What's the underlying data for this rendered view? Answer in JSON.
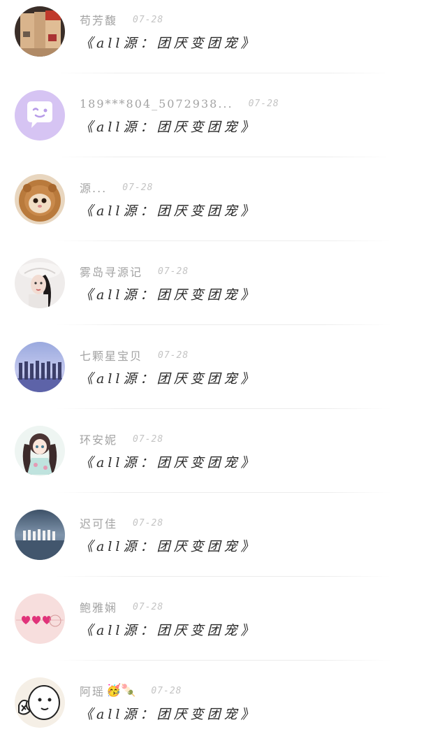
{
  "comments": [
    {
      "name": "苟芳馥",
      "date": "07-28",
      "message": "《all源：团厌变团宠》",
      "avatar_icon": "books-avatar"
    },
    {
      "name": "189***804_5072938...",
      "date": "07-28",
      "message": "《all源：团厌变团宠》",
      "avatar_icon": "wink-chat-bubble-avatar"
    },
    {
      "name": "源...",
      "date": "07-28",
      "message": "《all源：团厌变团宠》",
      "avatar_icon": "lion-cat-avatar"
    },
    {
      "name": "雾岛寻源记",
      "date": "07-28",
      "message": "《all源：团厌变团宠》",
      "avatar_icon": "girl-with-hat-avatar"
    },
    {
      "name": "七颗星宝贝",
      "date": "07-28",
      "message": "《all源：团厌变团宠》",
      "avatar_icon": "group-on-stage-avatar"
    },
    {
      "name": "环安妮",
      "date": "07-28",
      "message": "《all源：团厌变团宠》",
      "avatar_icon": "anime-girl-avatar"
    },
    {
      "name": "迟可佳",
      "date": "07-28",
      "message": "《all源：团厌变团宠》",
      "avatar_icon": "group-on-beach-avatar"
    },
    {
      "name": "鲍雅娴",
      "date": "07-28",
      "message": "《all源：团厌变团宠》",
      "avatar_icon": "pink-hearts-avatar"
    },
    {
      "name": "阿瑶",
      "name_emojis": "🥳🍡",
      "date": "07-28",
      "message": "《all源：团厌变团宠》",
      "avatar_icon": "cartoon-doodle-avatar"
    }
  ]
}
